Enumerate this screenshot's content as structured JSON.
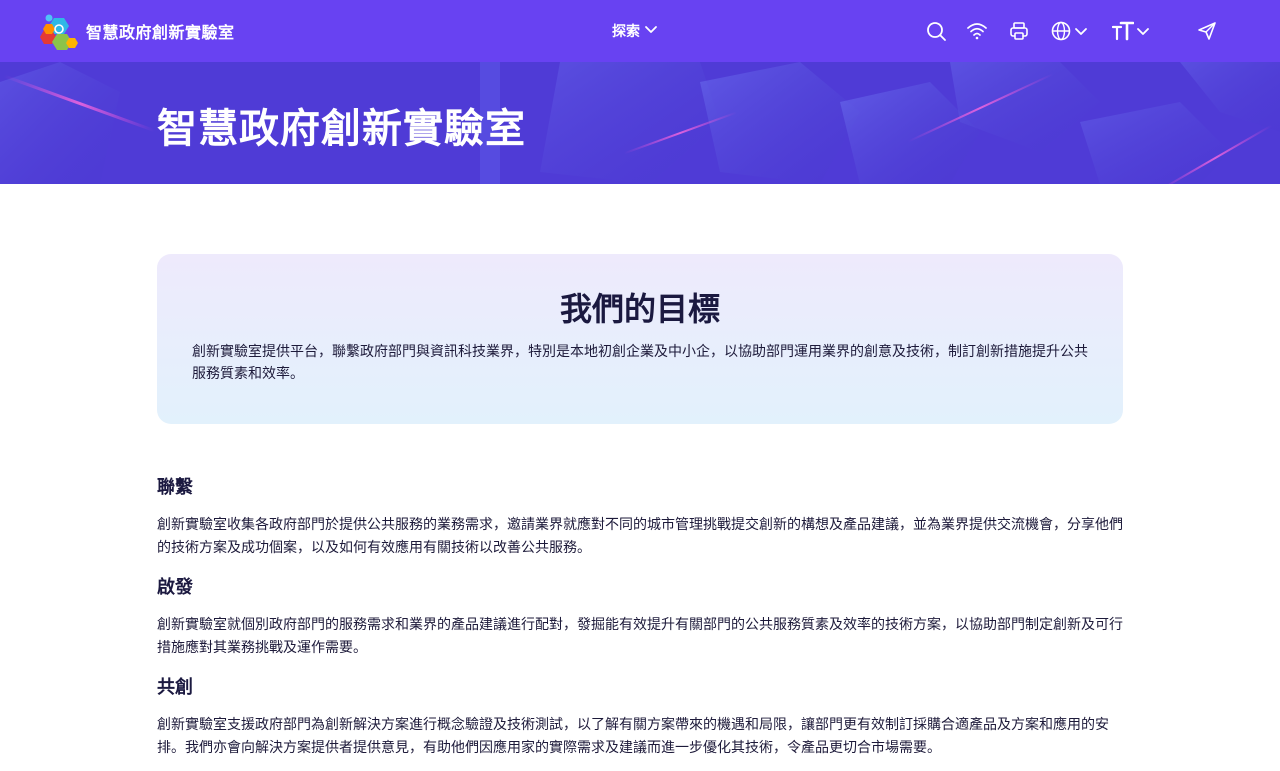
{
  "header": {
    "site_name": "智慧政府創新實驗室",
    "explore_label": "探索",
    "icons": [
      "search-icon",
      "wifi-icon",
      "print-icon",
      "globe-icon",
      "text-size-icon",
      "send-icon"
    ]
  },
  "banner": {
    "title": "智慧政府創新實驗室"
  },
  "goal": {
    "title": "我們的目標",
    "text": "創新實驗室提供平台，聯繫政府部門與資訊科技業界，特別是本地初創企業及中小企，以協助部門運用業界的創意及技術，制訂創新措施提升公共服務質素和效率。"
  },
  "sections": [
    {
      "heading": "聯繫",
      "text": "創新實驗室收集各政府部門於提供公共服務的業務需求，邀請業界就應對不同的城市管理挑戰提交創新的構想及產品建議，並為業界提供交流機會，分享他們的技術方案及成功個案，以及如何有效應用有關技術以改善公共服務。"
    },
    {
      "heading": "啟發",
      "text": "創新實驗室就個別政府部門的服務需求和業界的產品建議進行配對，發掘能有效提升有關部門的公共服務質素及效率的技術方案，以協助部門制定創新及可行措施應對其業務挑戰及運作需要。"
    },
    {
      "heading": "共創",
      "text": "創新實驗室支援政府部門為創新解決方案進行概念驗證及技術測試，以了解有關方案帶來的機遇和局限，讓部門更有效制訂採購合適產品及方案和應用的安排。我們亦會向解決方案提供者提供意見，有助他們因應用家的實際需求及建議而進一步優化其技術，令產品更切合市場需要。"
    }
  ],
  "colors": {
    "header_bg": "#6842f2",
    "banner_bg": "#4c3bd4",
    "heading_text": "#1b1940"
  }
}
